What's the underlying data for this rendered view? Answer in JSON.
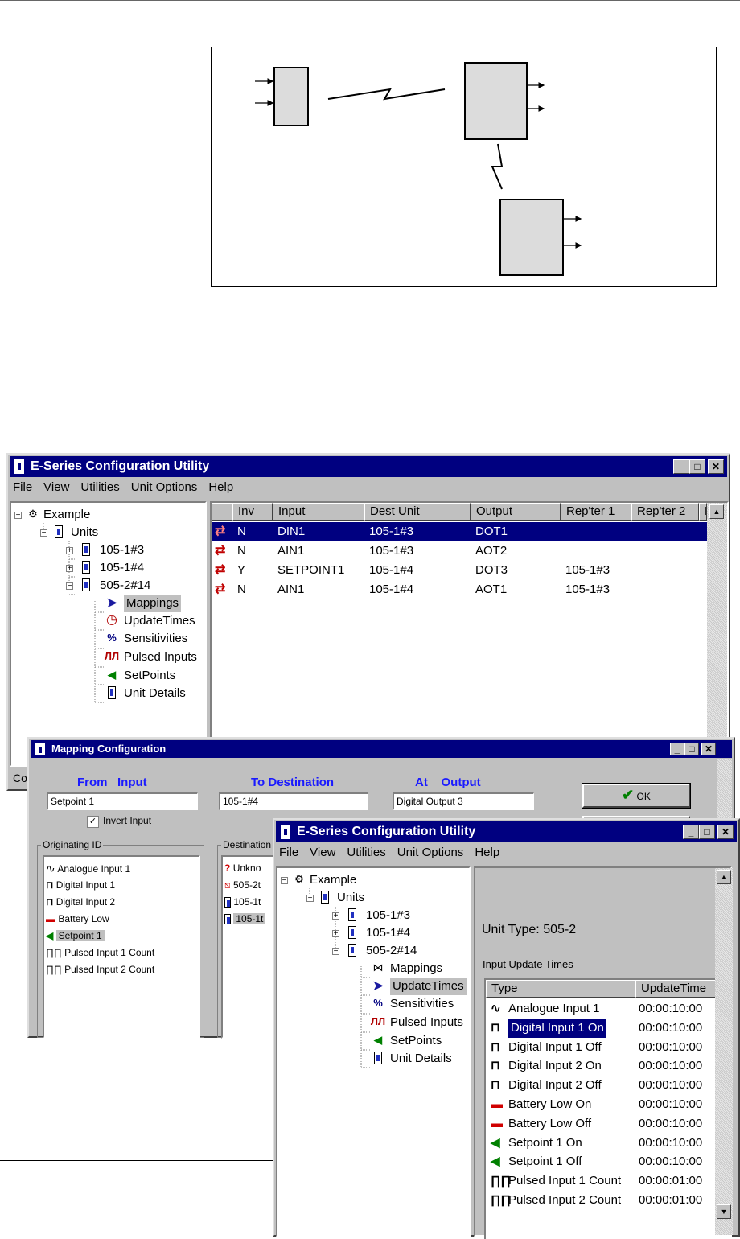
{
  "main_window": {
    "title": "E-Series Configuration Utility",
    "menu": [
      "File",
      "View",
      "Utilities",
      "Unit Options",
      "Help"
    ],
    "tree": {
      "root": "Example",
      "units_label": "Units",
      "units": [
        "105-1#3",
        "105-1#4",
        "505-2#14"
      ],
      "children": [
        "Mappings",
        "UpdateTimes",
        "Sensitivities",
        "Pulsed Inputs",
        "SetPoints",
        "Unit Details"
      ],
      "selected": "Mappings"
    },
    "table": {
      "columns": [
        "Inv",
        "Input",
        "Dest Unit",
        "Output",
        "Rep'ter 1",
        "Rep'ter 2",
        "F"
      ],
      "rows": [
        {
          "inv": "N",
          "input": "DIN1",
          "dest": "105-1#3",
          "output": "DOT1",
          "rep1": ""
        },
        {
          "inv": "N",
          "input": "AIN1",
          "dest": "105-1#3",
          "output": "AOT2",
          "rep1": ""
        },
        {
          "inv": "Y",
          "input": "SETPOINT1",
          "dest": "105-1#4",
          "output": "DOT3",
          "rep1": "105-1#3"
        },
        {
          "inv": "N",
          "input": "AIN1",
          "dest": "105-1#4",
          "output": "AOT1",
          "rep1": "105-1#3"
        }
      ]
    },
    "status_text": "Co"
  },
  "mapping_dialog": {
    "title": "Mapping Configuration",
    "from_label": "From   Input",
    "to_label": "To Destination",
    "at_label": "At    Output",
    "from_value": "Setpoint 1",
    "to_value": "105-1#4",
    "at_value": "Digital Output 3",
    "invert_label": "Invert Input",
    "invert_checked": "✓",
    "ok_label": "OK",
    "originating_label": "Originating ID",
    "originating_items": [
      "Analogue Input 1",
      "Digital Input 1",
      "Digital Input 2",
      "Battery Low",
      "Setpoint 1",
      "Pulsed Input 1 Count",
      "Pulsed Input 2 Count"
    ],
    "originating_selected": "Setpoint 1",
    "destination_label": "Destination",
    "destination_items": [
      "Unkno",
      "505-2t",
      "105-1t",
      "105-1t"
    ]
  },
  "second_window": {
    "title": "E-Series Configuration Utility",
    "menu": [
      "File",
      "View",
      "Utilities",
      "Unit Options",
      "Help"
    ],
    "tree": {
      "root": "Example",
      "units_label": "Units",
      "units": [
        "105-1#3",
        "105-1#4",
        "505-2#14"
      ],
      "children": [
        "Mappings",
        "UpdateTimes",
        "Sensitivities",
        "Pulsed Inputs",
        "SetPoints",
        "Unit Details"
      ],
      "selected": "UpdateTimes"
    },
    "unit_type": "Unit Type: 505-2",
    "group_label": "Input Update Times",
    "columns": [
      "Type",
      "UpdateTime"
    ],
    "rows": [
      {
        "type": "Analogue Input 1",
        "time": "00:00:10:00",
        "icon": "analogue-wave-icon"
      },
      {
        "type": "Digital Input 1 On",
        "time": "00:00:10:00",
        "icon": "digital-pulse-icon"
      },
      {
        "type": "Digital Input 1 Off",
        "time": "00:00:10:00",
        "icon": "digital-pulse-icon"
      },
      {
        "type": "Digital Input 2 On",
        "time": "00:00:10:00",
        "icon": "digital-pulse-icon"
      },
      {
        "type": "Digital Input 2 Off",
        "time": "00:00:10:00",
        "icon": "digital-pulse-icon"
      },
      {
        "type": "Battery Low On",
        "time": "00:00:10:00",
        "icon": "battery-icon"
      },
      {
        "type": "Battery Low Off",
        "time": "00:00:10:00",
        "icon": "battery-icon"
      },
      {
        "type": "Setpoint 1 On",
        "time": "00:00:10:00",
        "icon": "setpoint-icon"
      },
      {
        "type": "Setpoint 1 Off",
        "time": "00:00:10:00",
        "icon": "setpoint-icon"
      },
      {
        "type": "Pulsed Input 1 Count",
        "time": "00:00:01:00",
        "icon": "pulse-train-icon"
      },
      {
        "type": "Pulsed Input 2 Count",
        "time": "00:00:01:00",
        "icon": "pulse-train-icon"
      }
    ],
    "selected_row": "Digital Input 1 On"
  },
  "colors": {
    "titlebar": "#000080",
    "window_face": "#c0c0c0",
    "label_blue": "#1a1aff",
    "arrow_red": "#c00000"
  }
}
